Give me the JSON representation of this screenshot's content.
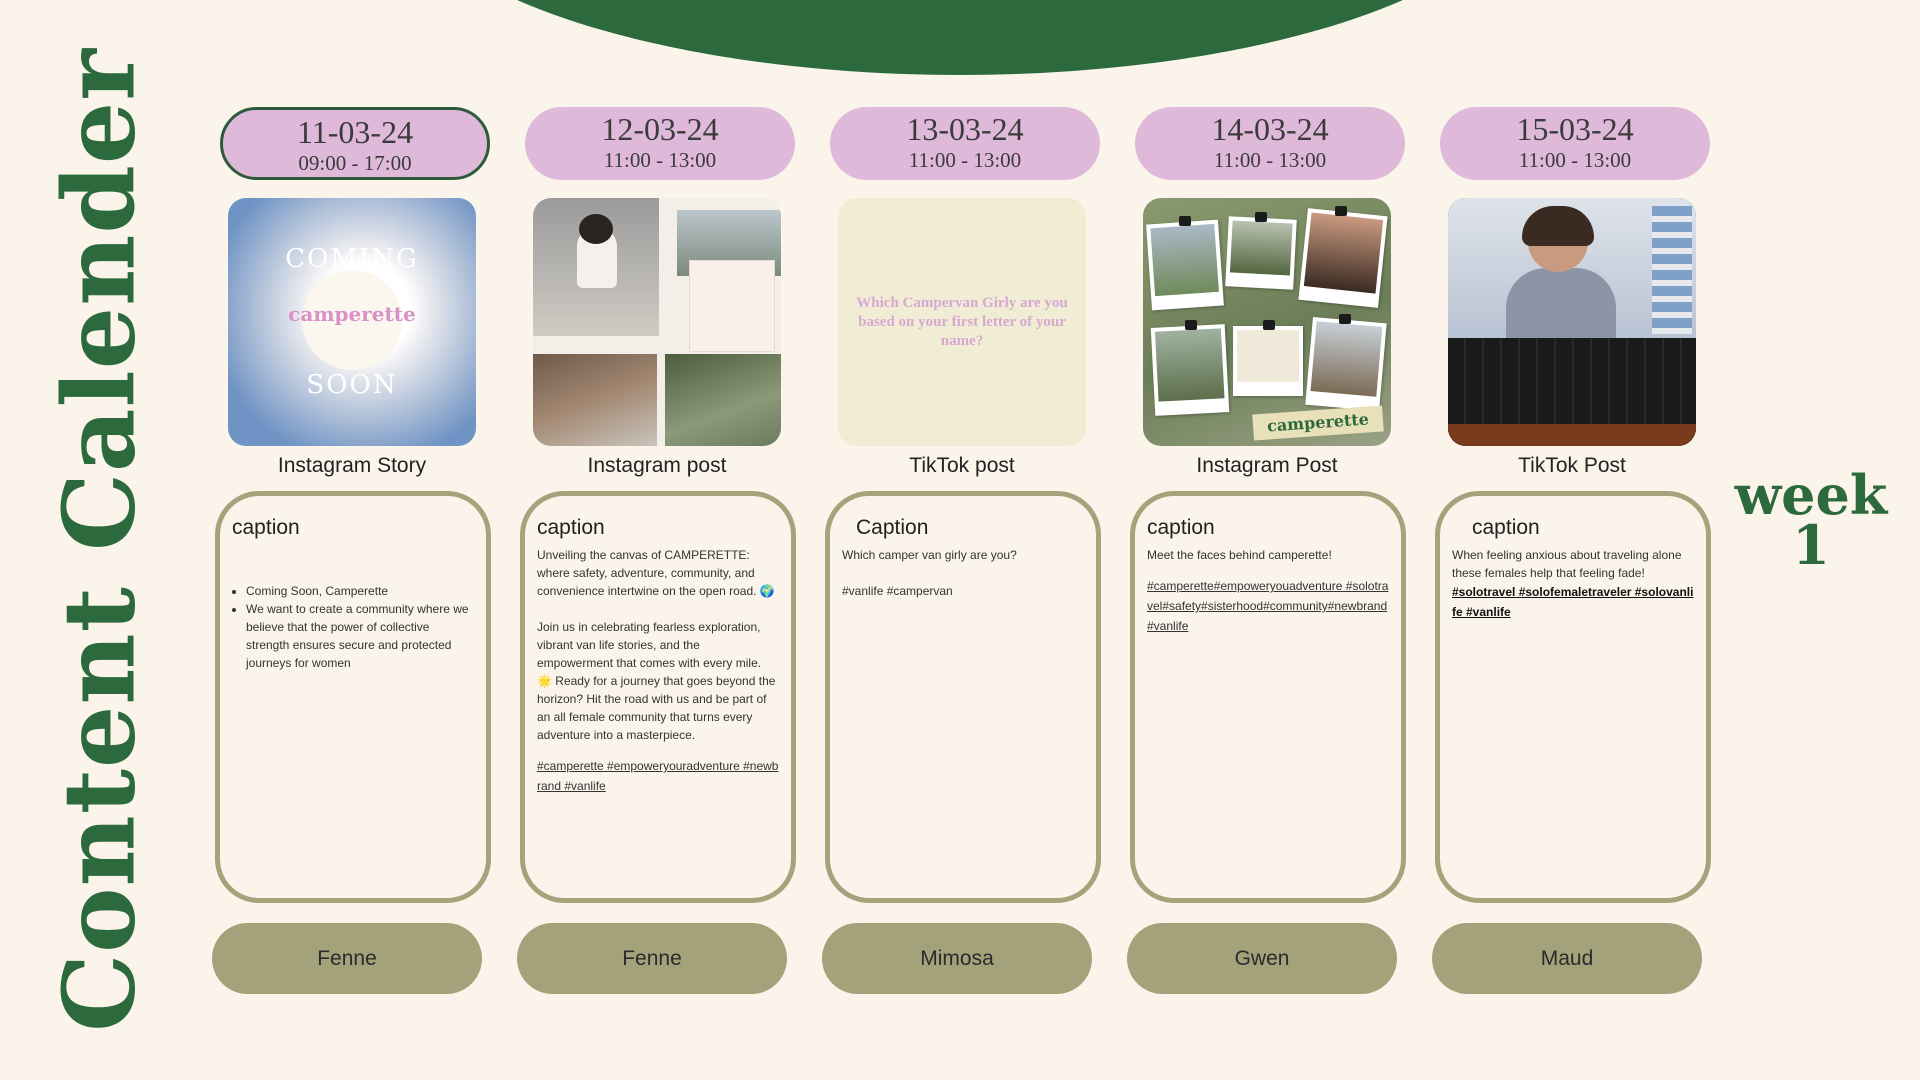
{
  "title": "Content Calender",
  "week": {
    "word": "week",
    "number": "1"
  },
  "days": [
    {
      "date": "11-03-24",
      "time": "09:00 - 17:00",
      "post_type": "Instagram Story",
      "caption_title": "caption",
      "caption_bullets": [
        "Coming Soon, Camperette",
        "We want to create a community where we believe that the power of collective strength ensures secure and protected journeys for women"
      ],
      "person": "Fenne",
      "thumbnail": {
        "kind": "clouds",
        "top_text": "COMING",
        "brand": "camperette",
        "bottom_text": "SOON"
      }
    },
    {
      "date": "12-03-24",
      "time": "11:00 - 13:00",
      "post_type": "Instagram post",
      "caption_title": "caption",
      "caption_text": "Unveiling the canvas of CAMPERETTE: where safety, adventure, community, and convenience intertwine on the open road. 🌍\n\nJoin us in celebrating fearless exploration, vibrant van life stories, and the empowerment that comes with every mile. 🌟 Ready for a journey that goes beyond the horizon? Hit the road with us and be part of an all female community that turns every adventure into a masterpiece.",
      "hashtags": "#camperette #empoweryouradventure #newbrand #vanlife",
      "person": "Fenne",
      "thumbnail": {
        "kind": "collage"
      }
    },
    {
      "date": "13-03-24",
      "time": "11:00  - 13:00",
      "post_type": "TikTok post",
      "caption_title": "Caption",
      "caption_text": "Which camper van girly are you?\n\n#vanlife #campervan",
      "person": "Mimosa",
      "thumbnail": {
        "kind": "quiz",
        "text": "Which Campervan Girly are you based on your first letter of your name?"
      }
    },
    {
      "date": "14-03-24",
      "time": "11:00 - 13:00",
      "post_type": "Instagram Post",
      "caption_title": "caption",
      "caption_text": "Meet the faces behind camperette!",
      "hashtags": "#camperette#empoweryouadventure #solotravel#safety#sisterhood#community#newbrand#vanlife",
      "person": "Gwen",
      "thumbnail": {
        "kind": "board",
        "brand": "camperette"
      }
    },
    {
      "date": "15-03-24",
      "time": "11:00 - 13:00",
      "post_type": "TikTok Post",
      "caption_title": "caption",
      "caption_text": "When feeling anxious about traveling alone these females help that feeling fade!",
      "hashtags_bold": "#solotravel #solofemaletraveler #solovanlife #vanlife",
      "person": "Maud",
      "thumbnail": {
        "kind": "video"
      }
    }
  ],
  "colors": {
    "green": "#2c6a3d",
    "pink": "#dfb9d9",
    "olive": "#a3a27a",
    "cream": "#faf4ea"
  }
}
